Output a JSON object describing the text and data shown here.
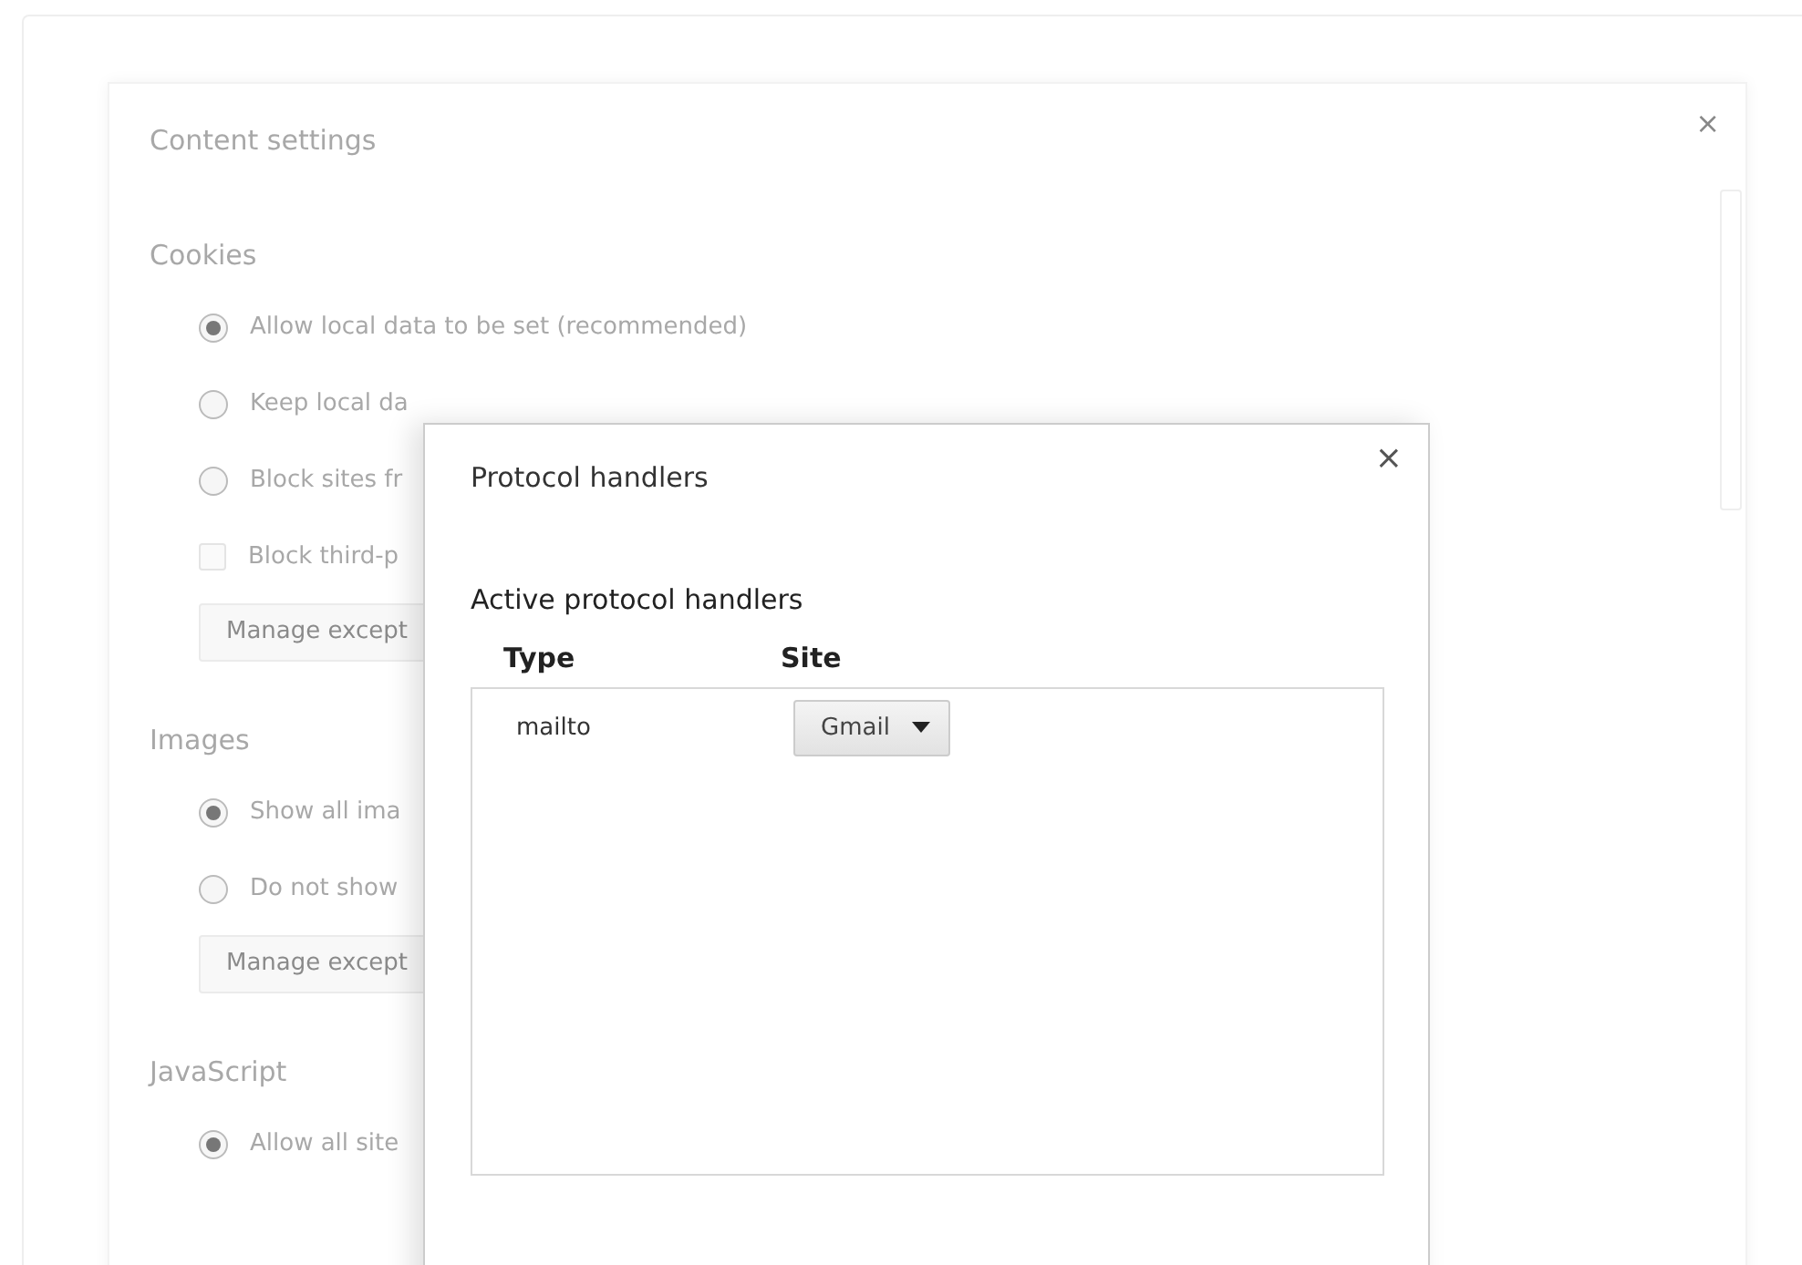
{
  "background_dialog": {
    "title": "Content settings",
    "close": "×",
    "sections": [
      {
        "heading": "Cookies",
        "options": [
          {
            "kind": "radio",
            "label": "Allow local data to be set (recommended)",
            "checked": true
          },
          {
            "kind": "radio",
            "label": "Keep local da",
            "checked": false
          },
          {
            "kind": "radio",
            "label": "Block sites fr",
            "checked": false
          },
          {
            "kind": "checkbox",
            "label": "Block third-p",
            "checked": false
          },
          {
            "kind": "button",
            "label": "Manage except"
          }
        ]
      },
      {
        "heading": "Images",
        "options": [
          {
            "kind": "radio",
            "label": "Show all ima",
            "checked": true
          },
          {
            "kind": "radio",
            "label": "Do not show",
            "checked": false
          },
          {
            "kind": "button",
            "label": "Manage except"
          }
        ]
      },
      {
        "heading": "JavaScript",
        "options": [
          {
            "kind": "radio",
            "label": "Allow all site",
            "checked": true
          }
        ]
      }
    ]
  },
  "dialog": {
    "title": "Protocol handlers",
    "close": "×",
    "section": "Active protocol handlers",
    "columns": [
      "Type",
      "Site"
    ],
    "rows": [
      {
        "type": "mailto",
        "site": "Gmail"
      }
    ]
  }
}
